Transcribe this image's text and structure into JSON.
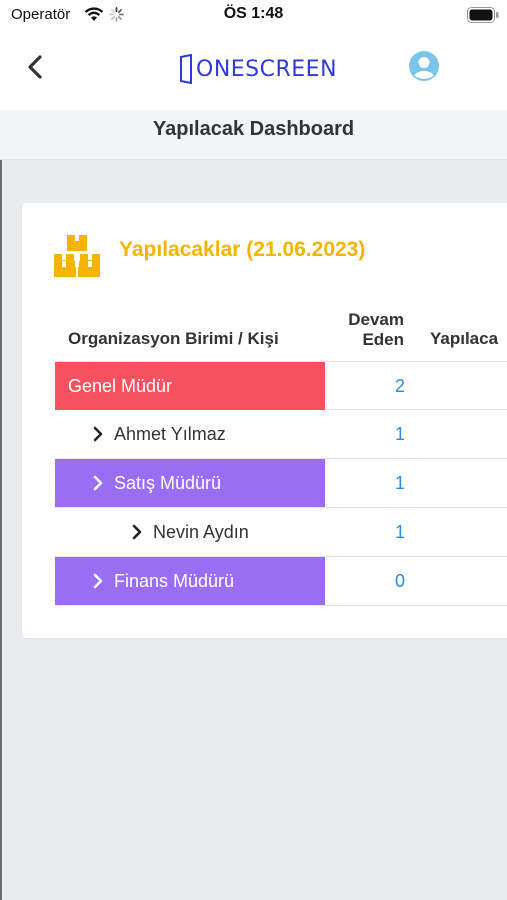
{
  "status_bar": {
    "carrier": "Operatör",
    "time": "ÖS 1:48"
  },
  "nav": {
    "logo_text": "ONESCREEN",
    "brand_color": "#2f3bd6"
  },
  "page": {
    "title": "Yapılacak Dashboard"
  },
  "card": {
    "title": "Yapılacaklar (21.06.2023)",
    "title_color": "#f4b400",
    "columns": {
      "org": "Organizasyon Birimi / Kişi",
      "devam_line1": "Devam",
      "devam_line2": "Eden",
      "yapilacak": "Yapılaca"
    },
    "rows": [
      {
        "name": "Genel Müdür",
        "value": "2",
        "style": "red"
      },
      {
        "name": "Ahmet Yılmaz",
        "value": "1",
        "style": "plain"
      },
      {
        "name": "Satış Müdürü",
        "value": "1",
        "style": "purple"
      },
      {
        "name": "Nevin Aydın",
        "value": "1",
        "style": "plain"
      },
      {
        "name": "Finans Müdürü",
        "value": "0",
        "style": "purple"
      }
    ],
    "colors": {
      "red": "#f7515f",
      "purple": "#9b6df2",
      "value": "#2a8be0"
    }
  }
}
